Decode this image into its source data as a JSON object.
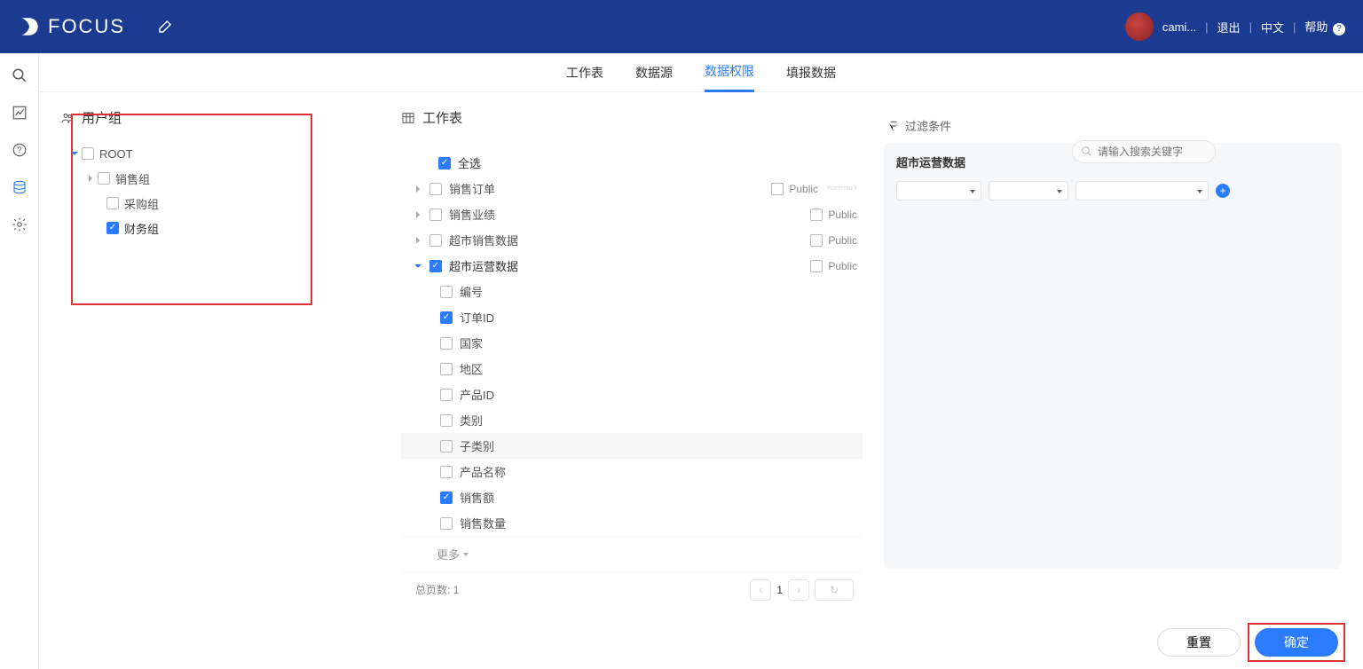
{
  "brand": "FOCUS",
  "user": {
    "name": "cami..."
  },
  "top": {
    "logout": "退出",
    "lang": "中文",
    "help": "帮助"
  },
  "tabs": [
    "工作表",
    "数据源",
    "数据权限",
    "填报数据"
  ],
  "tabs_active_index": 2,
  "panels": {
    "userGroup": {
      "title": "用户组",
      "root": "ROOT",
      "children": [
        "销售组",
        "采购组",
        "财务组"
      ]
    },
    "worksheet": {
      "title": "工作表",
      "searchPlaceholder": "请输入搜索关键字",
      "selectAll": "全选",
      "publicLabel": "Public",
      "items": [
        {
          "label": "销售订单",
          "expanded": false,
          "checked": false
        },
        {
          "label": "销售业绩",
          "expanded": false,
          "checked": false
        },
        {
          "label": "超市销售数据",
          "expanded": false,
          "checked": false
        },
        {
          "label": "超市运营数据",
          "expanded": true,
          "checked": true,
          "columns": [
            {
              "label": "编号",
              "checked": false
            },
            {
              "label": "订单ID",
              "checked": true
            },
            {
              "label": "国家",
              "checked": false
            },
            {
              "label": "地区",
              "checked": false
            },
            {
              "label": "产品ID",
              "checked": false
            },
            {
              "label": "类别",
              "checked": false
            },
            {
              "label": "子类别",
              "checked": false,
              "hl": true
            },
            {
              "label": "产品名称",
              "checked": false
            },
            {
              "label": "销售额",
              "checked": true
            },
            {
              "label": "销售数量",
              "checked": false
            }
          ]
        }
      ],
      "more": "更多",
      "pager": {
        "totalLabel": "总页数:",
        "total": "1",
        "current": "1"
      }
    },
    "filter": {
      "title": "过滤条件",
      "subject": "超市运营数据"
    }
  },
  "buttons": {
    "reset": "重置",
    "confirm": "确定"
  }
}
